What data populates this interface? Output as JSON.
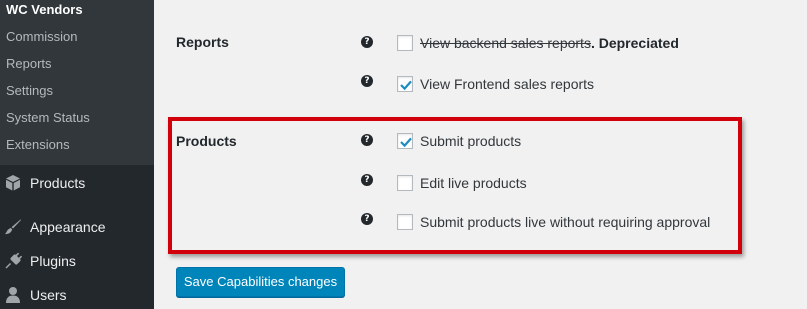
{
  "sidebar": {
    "submenu_title": "WC Vendors",
    "submenu_items": [
      "Commission",
      "Reports",
      "Settings",
      "System Status",
      "Extensions"
    ],
    "menu": [
      {
        "label": "Products",
        "icon": "box-icon"
      },
      {
        "label": "Appearance",
        "icon": "paintbrush-icon"
      },
      {
        "label": "Plugins",
        "icon": "plug-icon"
      },
      {
        "label": "Users",
        "icon": "user-icon"
      }
    ]
  },
  "reports": {
    "label": "Reports",
    "options": [
      {
        "text": "View backend sales reports",
        "suffix": ". Depreciated",
        "checked": false
      },
      {
        "text": "View Frontend sales reports",
        "checked": true
      }
    ]
  },
  "products": {
    "label": "Products",
    "options": [
      {
        "text": "Submit products",
        "checked": true
      },
      {
        "text": "Edit live products",
        "checked": false
      },
      {
        "text": "Submit products live without requiring approval",
        "checked": false
      }
    ]
  },
  "help_glyph": "?",
  "save_button": "Save Capabilities changes",
  "colors": {
    "sidebar_bg": "#23282d",
    "submenu_bg": "#32373c",
    "highlight_border": "#d1000b",
    "button_bg": "#0085ba",
    "checkmark": "#1e8cbe"
  }
}
